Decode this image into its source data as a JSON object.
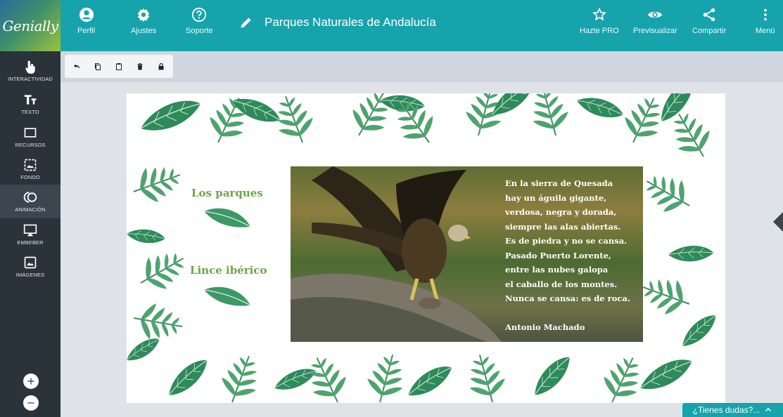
{
  "brand": {
    "logo_text": "Genially"
  },
  "topbar": {
    "profile_label": "Perfil",
    "settings_label": "Ajustes",
    "support_label": "Soporte",
    "title": "Parques Naturales de Andalucía",
    "pro_label": "Hazte PRO",
    "preview_label": "Previsualizar",
    "share_label": "Compartir",
    "menu_label": "Menú"
  },
  "sidebar": {
    "items": [
      {
        "label": "INTERACTIVIDAD",
        "icon": "pointer-hand-icon"
      },
      {
        "label": "TEXTO",
        "icon": "text-icon"
      },
      {
        "label": "RECURSOS",
        "icon": "resources-icon"
      },
      {
        "label": "FONDO",
        "icon": "background-icon"
      },
      {
        "label": "ANIMACIÓN",
        "icon": "animation-icon"
      },
      {
        "label": "EMBEBER",
        "icon": "embed-icon"
      },
      {
        "label": "IMÁGENES",
        "icon": "images-icon"
      }
    ]
  },
  "toolbar": {
    "tools": [
      "undo-icon",
      "copy-icon",
      "paste-icon",
      "delete-icon",
      "lock-icon"
    ]
  },
  "canvas": {
    "labels": [
      "Los parques",
      "Lince ibérico"
    ],
    "poem": {
      "lines": [
        "En la sierra de Quesada",
        "hay un águila gigante,",
        "verdosa, negra y dorada,",
        "siempre las alas abiertas.",
        "Es de piedra y no se cansa.",
        "Pasado Puerto Lorente,",
        "entre las nubes galopa",
        "el caballo de los montes.",
        "Nunca se cansa: es de roca."
      ],
      "author": "Antonio Machado"
    }
  },
  "help": {
    "label": "¿Tienes dudas?..."
  },
  "colors": {
    "accent": "#17a3ac",
    "sidebar": "#2a323a",
    "leaf_green": "#6ea54a"
  }
}
